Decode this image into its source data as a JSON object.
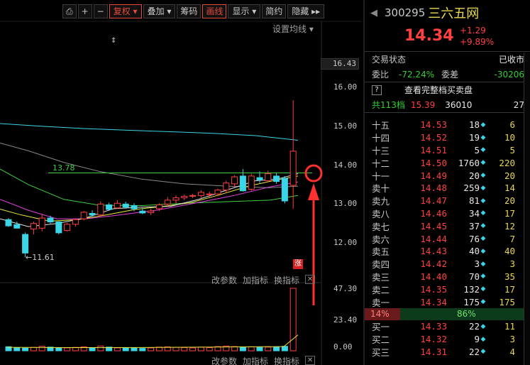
{
  "toolbar": {
    "buttons": [
      {
        "label": "⎙",
        "name": "toolbar-copy-button"
      },
      {
        "label": "+",
        "name": "toolbar-zoom-in-button"
      },
      {
        "label": "−",
        "name": "toolbar-zoom-out-button"
      },
      {
        "label": "复权 ▾",
        "name": "toolbar-fuquan-button",
        "active": true
      },
      {
        "label": "叠加 ▾",
        "name": "toolbar-overlay-button"
      },
      {
        "label": "筹码",
        "name": "toolbar-chips-button"
      },
      {
        "label": "画线",
        "name": "toolbar-draw-button",
        "active": true
      },
      {
        "label": "显示 ▾",
        "name": "toolbar-display-button"
      },
      {
        "label": "简约",
        "name": "toolbar-simple-button"
      },
      {
        "label": "隐藏 ▸▸",
        "name": "toolbar-hide-button"
      }
    ],
    "set_ma": "设置均线 ▾",
    "drag": "⇕"
  },
  "chart": {
    "price_ticks": [
      "16.00",
      "15.00",
      "14.00",
      "13.00",
      "12.00"
    ],
    "current_price": "16.43",
    "ma_value": "13.78",
    "low_label": "←11.61",
    "limit_badge": "涨",
    "vol_ticks": [
      "47.30",
      "23.40",
      "0.00"
    ],
    "ind_change": "改参数",
    "ind_add": "加指标",
    "ind_swap": "换指标",
    "ind_close": "✕"
  },
  "colors": {
    "up": "#ff4040",
    "down": "#3ad6e8",
    "ma_green": "#40d040",
    "ma_yellow": "#e8e840",
    "ma_magenta": "#e040e0",
    "ma_white": "#e0e0e0",
    "ma_cyan": "#3ad6e8",
    "ma_grey": "#888888",
    "annotation_red": "#ff3030"
  },
  "chart_data": {
    "type": "candlestick",
    "candles": [
      {
        "o": 12.58,
        "h": 12.62,
        "l": 12.39,
        "c": 12.42
      },
      {
        "o": 12.45,
        "h": 12.53,
        "l": 12.38,
        "c": 12.36
      },
      {
        "o": 12.2,
        "h": 12.25,
        "l": 11.61,
        "c": 11.72
      },
      {
        "o": 12.34,
        "h": 12.53,
        "l": 12.2,
        "c": 12.48
      },
      {
        "o": 12.36,
        "h": 12.72,
        "l": 12.28,
        "c": 12.62
      },
      {
        "o": 12.62,
        "h": 12.68,
        "l": 12.48,
        "c": 12.52
      },
      {
        "o": 12.52,
        "h": 12.54,
        "l": 12.2,
        "c": 12.24
      },
      {
        "o": 12.3,
        "h": 12.5,
        "l": 12.27,
        "c": 12.46
      },
      {
        "o": 12.46,
        "h": 12.6,
        "l": 12.4,
        "c": 12.58
      },
      {
        "o": 12.6,
        "h": 12.8,
        "l": 12.56,
        "c": 12.77
      },
      {
        "o": 12.74,
        "h": 12.82,
        "l": 12.64,
        "c": 12.7
      },
      {
        "o": 12.7,
        "h": 13.05,
        "l": 12.66,
        "c": 12.98
      },
      {
        "o": 12.96,
        "h": 13.02,
        "l": 12.82,
        "c": 12.84
      },
      {
        "o": 12.88,
        "h": 13.08,
        "l": 12.86,
        "c": 13.0
      },
      {
        "o": 12.98,
        "h": 13.04,
        "l": 12.86,
        "c": 12.9
      },
      {
        "o": 12.94,
        "h": 13.0,
        "l": 12.8,
        "c": 12.86
      },
      {
        "o": 12.8,
        "h": 12.88,
        "l": 12.72,
        "c": 12.75
      },
      {
        "o": 12.76,
        "h": 12.86,
        "l": 12.7,
        "c": 12.8
      },
      {
        "o": 12.86,
        "h": 13.0,
        "l": 12.8,
        "c": 12.96
      },
      {
        "o": 12.98,
        "h": 13.16,
        "l": 12.92,
        "c": 13.08
      },
      {
        "o": 13.08,
        "h": 13.2,
        "l": 13.0,
        "c": 13.14
      },
      {
        "o": 13.14,
        "h": 13.22,
        "l": 13.08,
        "c": 13.18
      },
      {
        "o": 13.18,
        "h": 13.24,
        "l": 13.14,
        "c": 13.2
      },
      {
        "o": 13.2,
        "h": 13.34,
        "l": 13.14,
        "c": 13.28
      },
      {
        "o": 13.22,
        "h": 13.3,
        "l": 13.16,
        "c": 13.24
      },
      {
        "o": 13.24,
        "h": 13.38,
        "l": 13.18,
        "c": 13.34
      },
      {
        "o": 13.34,
        "h": 13.58,
        "l": 13.26,
        "c": 13.52
      },
      {
        "o": 13.5,
        "h": 13.72,
        "l": 13.42,
        "c": 13.68
      },
      {
        "o": 13.7,
        "h": 13.88,
        "l": 13.3,
        "c": 13.32
      },
      {
        "o": 13.36,
        "h": 13.76,
        "l": 13.32,
        "c": 13.7
      },
      {
        "o": 13.66,
        "h": 13.82,
        "l": 13.52,
        "c": 13.6
      },
      {
        "o": 13.58,
        "h": 13.84,
        "l": 13.54,
        "c": 13.76
      },
      {
        "o": 13.7,
        "h": 13.78,
        "l": 13.5,
        "c": 13.56
      },
      {
        "o": 13.64,
        "h": 13.7,
        "l": 13.0,
        "c": 13.06
      },
      {
        "o": 13.46,
        "h": 15.65,
        "l": 12.86,
        "c": 14.34
      }
    ],
    "volumes": [
      3.1,
      2.2,
      2.0,
      2.6,
      3.4,
      2.8,
      2.4,
      2.2,
      2.6,
      3.0,
      2.4,
      3.6,
      2.8,
      2.2,
      2.4,
      2.0,
      1.8,
      2.2,
      2.8,
      3.0,
      2.6,
      2.4,
      2.2,
      2.8,
      2.4,
      3.2,
      3.6,
      3.2,
      2.6,
      3.0,
      2.6,
      2.8,
      3.0,
      3.4,
      47.3
    ],
    "price_range": [
      11.4,
      16.6
    ],
    "volume_range": [
      0,
      47.3
    ],
    "annotation": "hand-drawn circle with upward arrow at the last bar"
  },
  "panel": {
    "code": "300295",
    "name": "三六五网",
    "price": "14.34",
    "change": "+1.29",
    "change_pct": "+9.89%",
    "status_label": "交易状态",
    "status_value": "已收市",
    "weibi_label": "委比",
    "weibi_value": "-72.24%",
    "weicha_label": "委差",
    "weicha_value": "-30206",
    "full_book_icon": "?",
    "full_book_label": "查看完整档买卖盘",
    "total_levels": "共113档",
    "total_price": "15.39",
    "total_vol": "36010",
    "total_ex": "27",
    "book": [
      {
        "lv": "十五",
        "pr": "14.53",
        "vl": "18",
        "dot": "◆",
        "ex": "6"
      },
      {
        "lv": "十四",
        "pr": "14.52",
        "vl": "19",
        "dot": "◆",
        "ex": "10"
      },
      {
        "lv": "十三",
        "pr": "14.51",
        "vl": "5",
        "dot": "◆",
        "ex": "5"
      },
      {
        "lv": "十二",
        "pr": "14.50",
        "vl": "1760",
        "dot": "◆",
        "ex": "220"
      },
      {
        "lv": "十一",
        "pr": "14.49",
        "vl": "20",
        "dot": "◆",
        "ex": "20"
      },
      {
        "lv": "卖十",
        "pr": "14.48",
        "vl": "259",
        "dot": "◆",
        "ex": "14"
      },
      {
        "lv": "卖九",
        "pr": "14.47",
        "vl": "81",
        "dot": "◆",
        "ex": "20"
      },
      {
        "lv": "卖八",
        "pr": "14.46",
        "vl": "34",
        "dot": "◆",
        "ex": "17"
      },
      {
        "lv": "卖七",
        "pr": "14.45",
        "vl": "37",
        "dot": "◆",
        "ex": "12"
      },
      {
        "lv": "卖六",
        "pr": "14.44",
        "vl": "76",
        "dot": "◆",
        "ex": "7"
      },
      {
        "lv": "卖五",
        "pr": "14.43",
        "vl": "40",
        "dot": "◆",
        "ex": "40"
      },
      {
        "lv": "卖四",
        "pr": "14.42",
        "vl": "3",
        "dot": "◆",
        "ex": "3"
      },
      {
        "lv": "卖三",
        "pr": "14.40",
        "vl": "70",
        "dot": "◆",
        "ex": "35"
      },
      {
        "lv": "卖二",
        "pr": "14.35",
        "vl": "132",
        "dot": "◆",
        "ex": "17"
      },
      {
        "lv": "卖一",
        "pr": "14.34",
        "vl": "175",
        "dot": "◆",
        "ex": "175"
      }
    ],
    "ratio_left": "14%",
    "ratio_right": "86%",
    "bids": [
      {
        "lv": "买一",
        "pr": "14.33",
        "vl": "22",
        "dot": "◆",
        "ex": "11"
      },
      {
        "lv": "买二",
        "pr": "14.32",
        "vl": "9",
        "dot": "◆",
        "ex": "3"
      },
      {
        "lv": "买三",
        "pr": "14.31",
        "vl": "22",
        "dot": "◆",
        "ex": "4"
      }
    ]
  }
}
